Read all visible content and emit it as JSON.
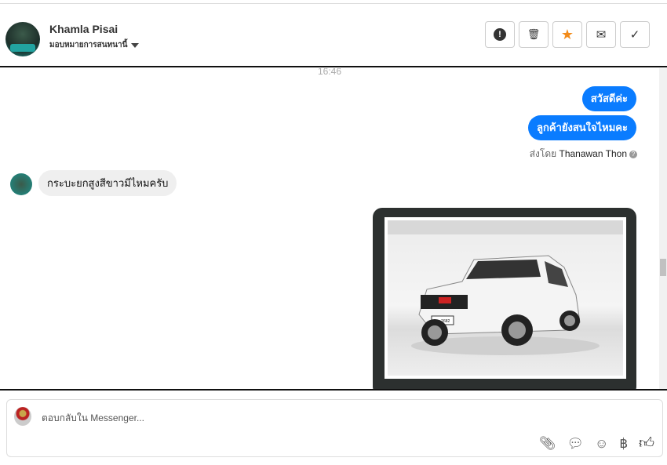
{
  "header": {
    "name": "Khamla Pisai",
    "assign_label": "มอบหมายการสนทนานี้"
  },
  "toolbar": {
    "spam": "!",
    "delete": "🗑",
    "star": "★",
    "mail": "✉",
    "done": "✓"
  },
  "colors": {
    "accent": "#0a7cff",
    "star": "#f28b1a"
  },
  "chat": {
    "timestamp": "16:46",
    "outgoing": [
      "สวัสดีค่ะ",
      "ลูกค้ายังสนใจไหมคะ"
    ],
    "sent_by_prefix": "ส่งโดย",
    "sent_by_name": "Thanawan Thon",
    "incoming": "กระบะยกสูงสีขาวมีไหมครับ",
    "image_plate": "ฎฐ 2682"
  },
  "composer": {
    "placeholder": "ตอบกลับใน Messenger..."
  }
}
